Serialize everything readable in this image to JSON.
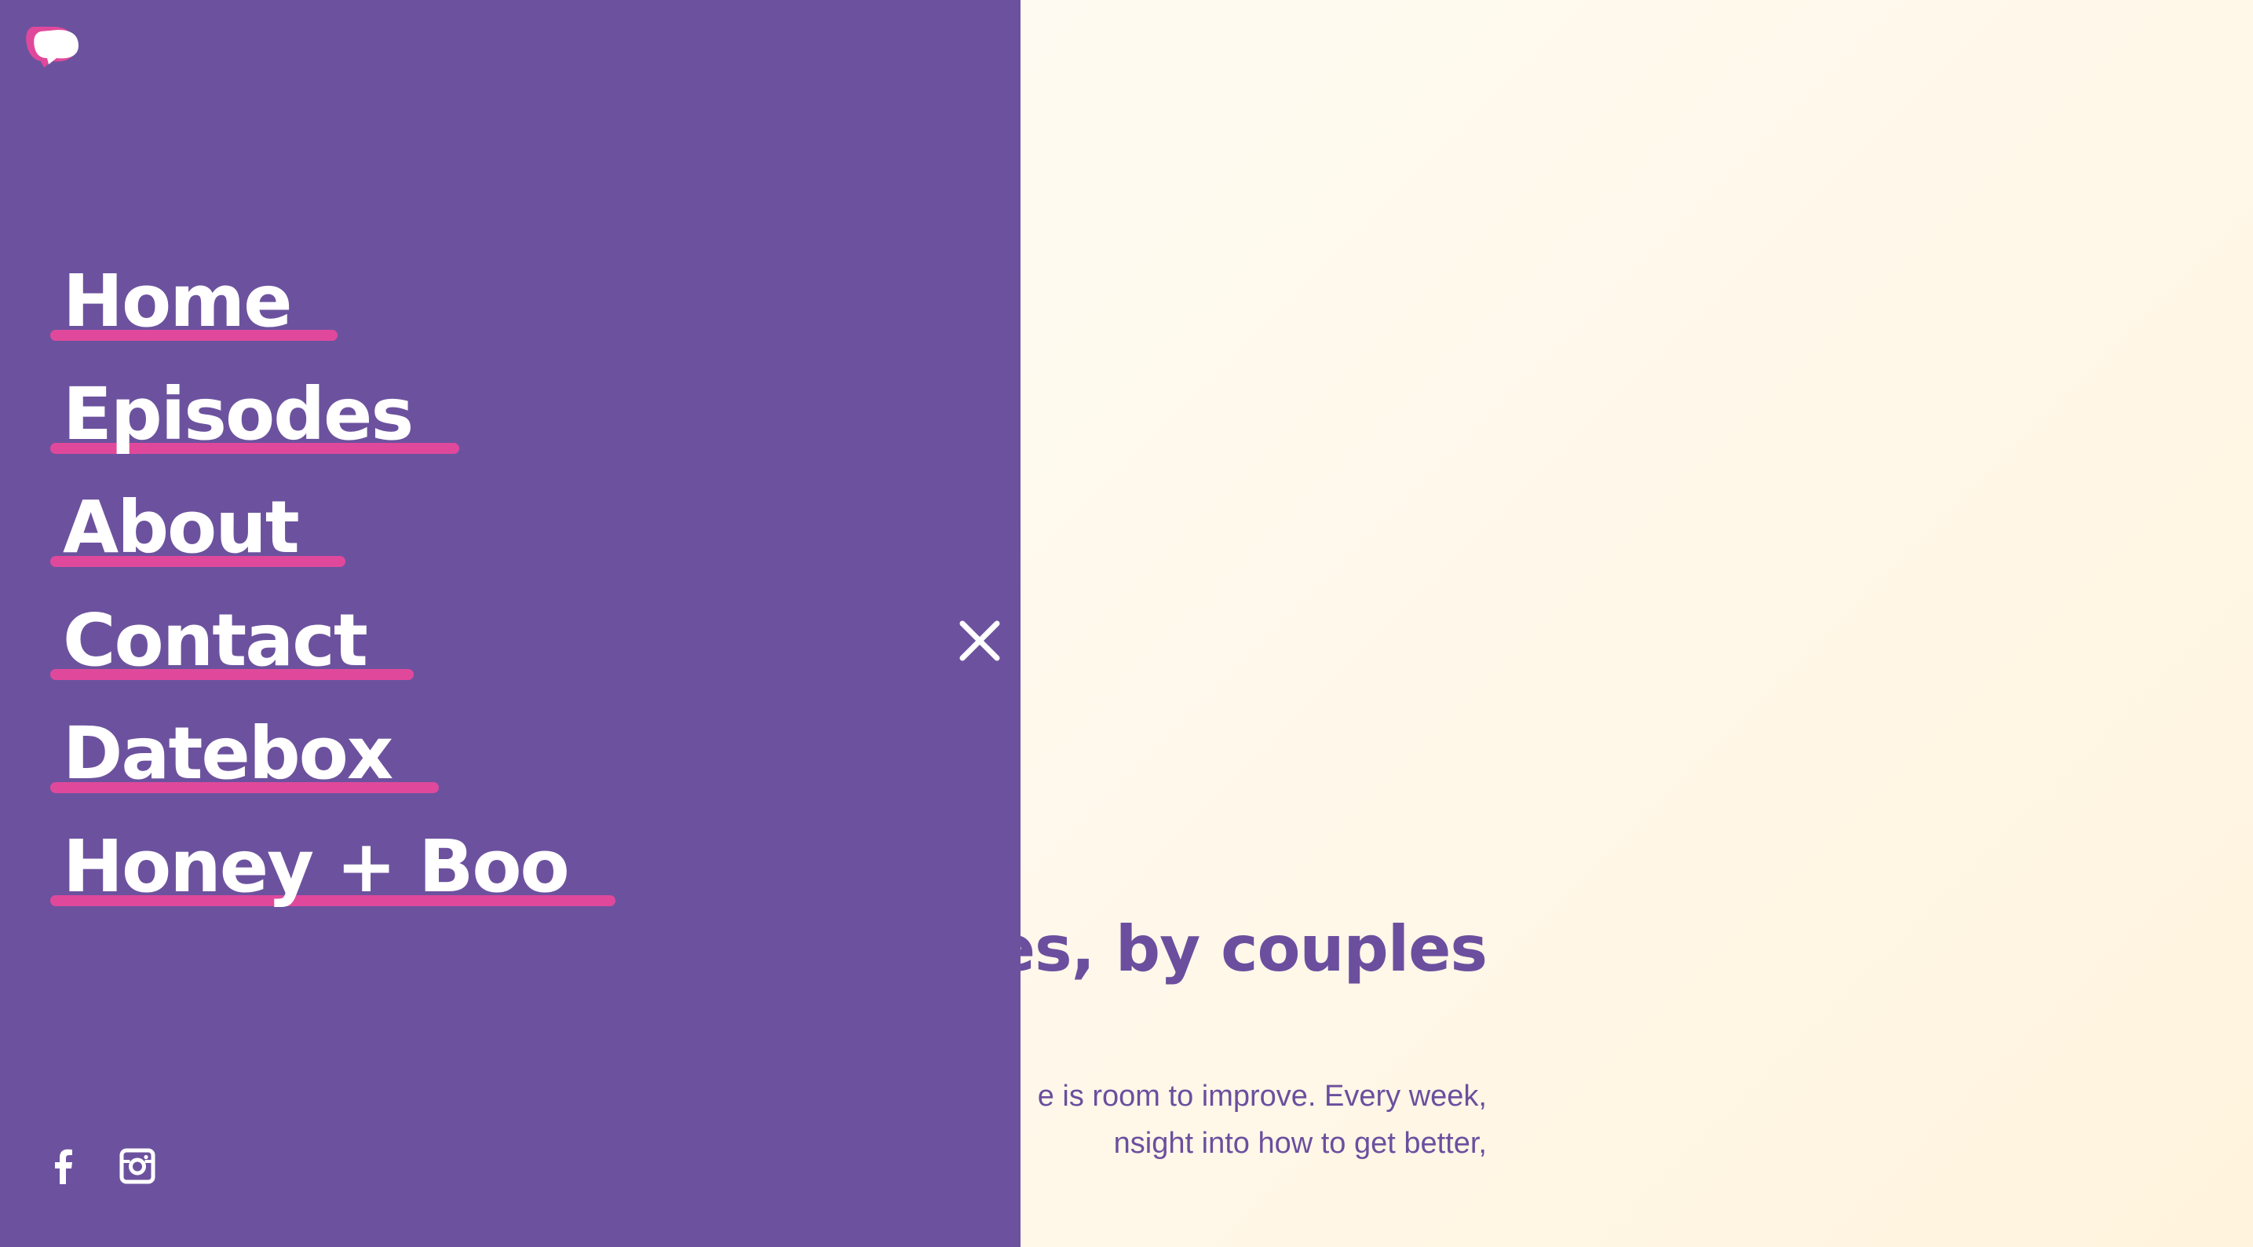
{
  "menu": {
    "items": [
      {
        "label": "Home"
      },
      {
        "label": "Episodes"
      },
      {
        "label": "About"
      },
      {
        "label": "Contact"
      },
      {
        "label": "Datebox"
      },
      {
        "label": "Honey + Boo"
      }
    ],
    "close_icon": "close-icon",
    "logo_icon": "speech-bubble-logo",
    "social": [
      {
        "icon": "facebook-icon"
      },
      {
        "icon": "instagram-icon"
      }
    ]
  },
  "hero": {
    "heading": "es, by couples",
    "body_lines": [
      "e is room to improve. Every week,",
      "nsight into how to get better,"
    ]
  },
  "colors": {
    "menu_background": "#6c529e",
    "underline_accent": "#e0499b",
    "hero_text": "#6b4f9e",
    "page_background": "#fff8ea"
  }
}
